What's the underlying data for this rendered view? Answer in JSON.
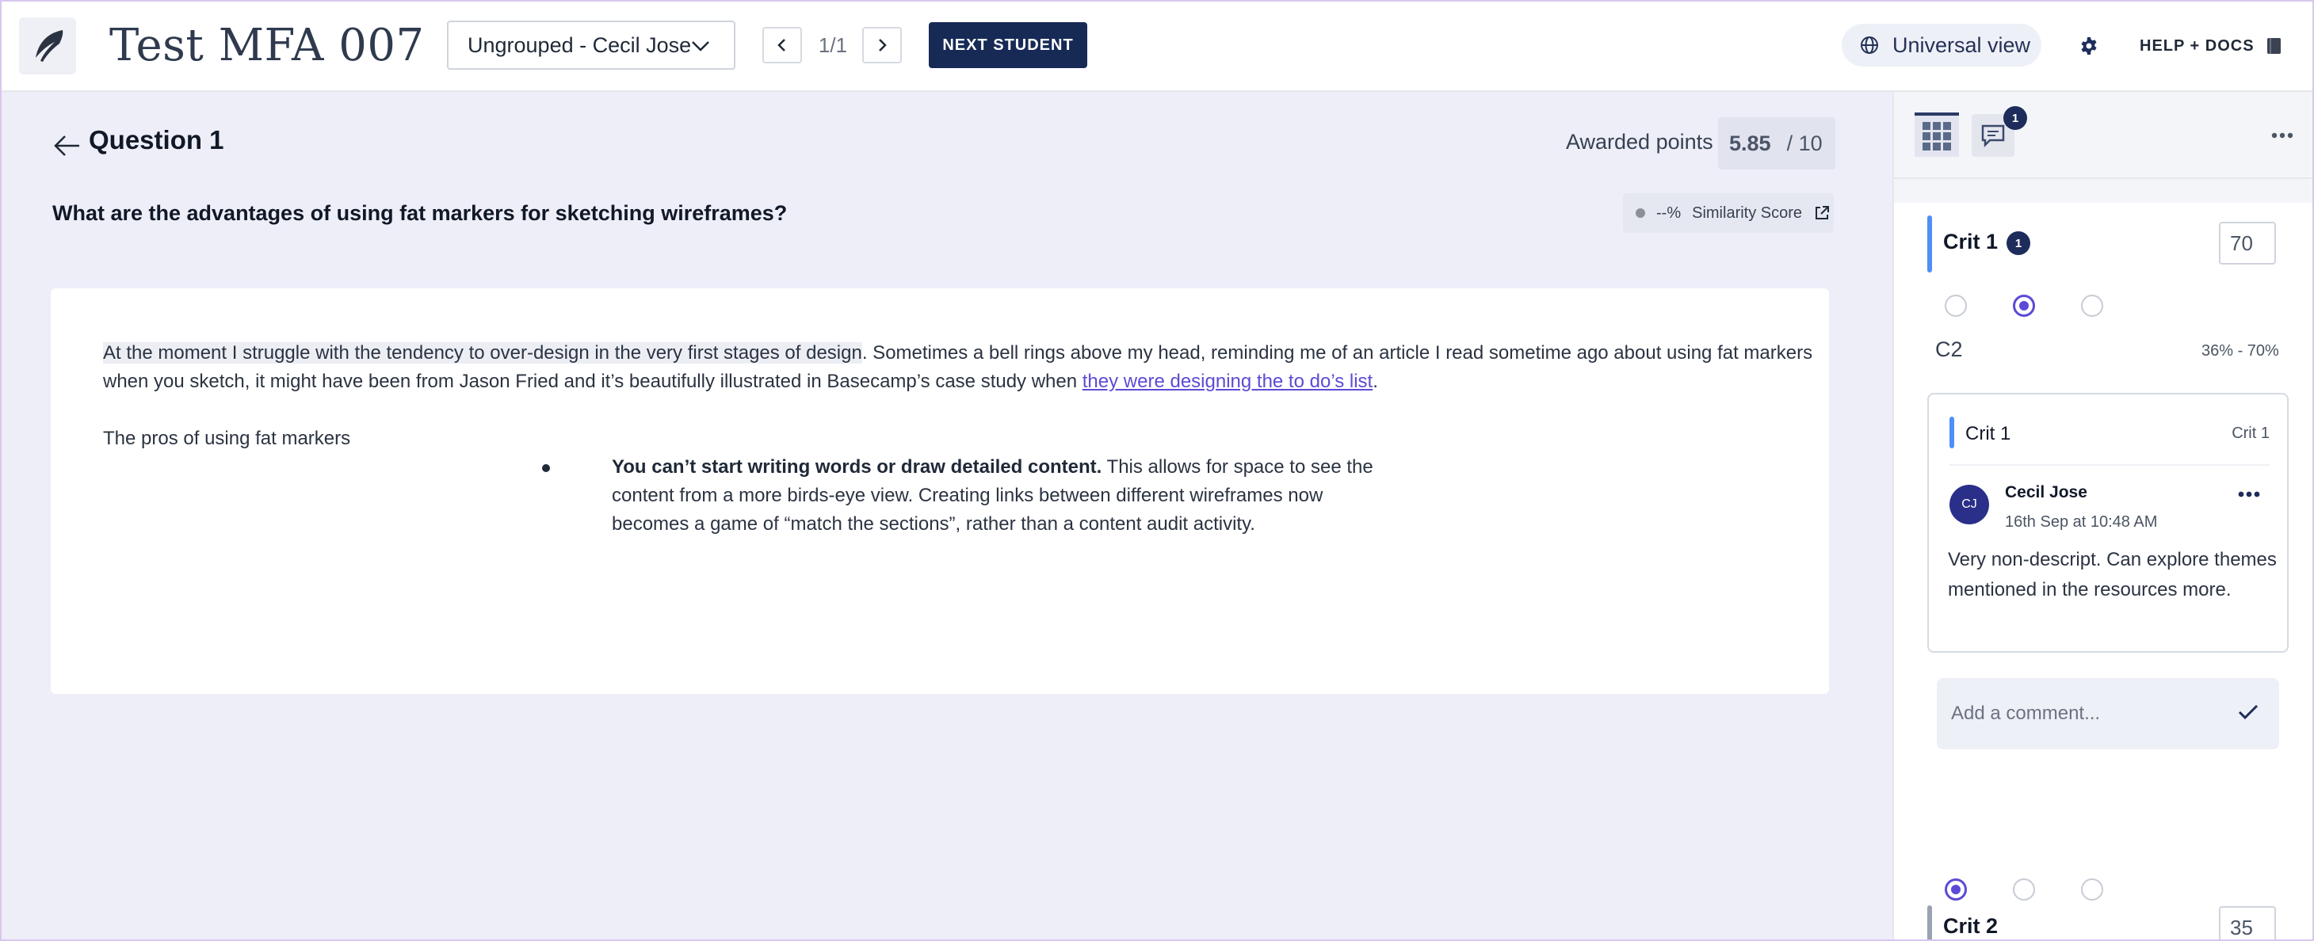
{
  "header": {
    "app_title": "Test MFA 007",
    "group_select": "Ungrouped - Cecil Jose",
    "page_count": "1/1",
    "next_student": "NEXT STUDENT",
    "view_toggle": "Universal view",
    "help": "HELP + DOCS"
  },
  "question": {
    "title": "Question 1",
    "awarded_label": "Awarded points",
    "awarded_value": "5.85",
    "awarded_max": "/ 10",
    "prompt": "What are the advantages of using fat markers for sketching wireframes?",
    "similarity_pct": "--%",
    "similarity_label": "Similarity Score"
  },
  "answer": {
    "highlighted": "At the moment I struggle with the tendency to over-design in the very first stages of design",
    "p1_after_highlight": ". Sometimes a bell rings above my head, reminding me of an article I read sometime ago about using fat markers when you sketch, it might have been from Jason Fried and it’s beautifully illustrated in Basecamp’s case study when ",
    "link": "they were designing the to do’s list",
    "p1_end": ".",
    "pros_heading": "The pros of using fat markers",
    "bullet_bold": "You can’t start writing words or draw detailed content.",
    "bullet_rest": " This allows for space to see the content from a more birds-eye view. Creating links between different wireframes now becomes a game of “match the sections”, rather than a content audit activity."
  },
  "panel": {
    "comments_badge": "1",
    "crit1": {
      "name": "Crit 1",
      "badge": "1",
      "score": "70",
      "selected_index": 1
    },
    "c2_label": "C2",
    "c2_range": "36% - 70%",
    "comment": {
      "crit_title": "Crit 1",
      "crit_tag": "Crit 1",
      "avatar_initials": "CJ",
      "author": "Cecil Jose",
      "date": "16th Sep at 10:48 AM",
      "text": "Very non-descript. Can explore themes mentioned in the resources more."
    },
    "comment_placeholder": "Add a comment...",
    "crit2": {
      "name": "Crit 2",
      "score": "35",
      "selected_index": 0
    }
  },
  "colors": {
    "primary_navy": "#172a56",
    "accent_purple": "#5b4bd6",
    "crit1_bar": "#4f8ef7",
    "crit2_bar": "#9aa3b2"
  }
}
